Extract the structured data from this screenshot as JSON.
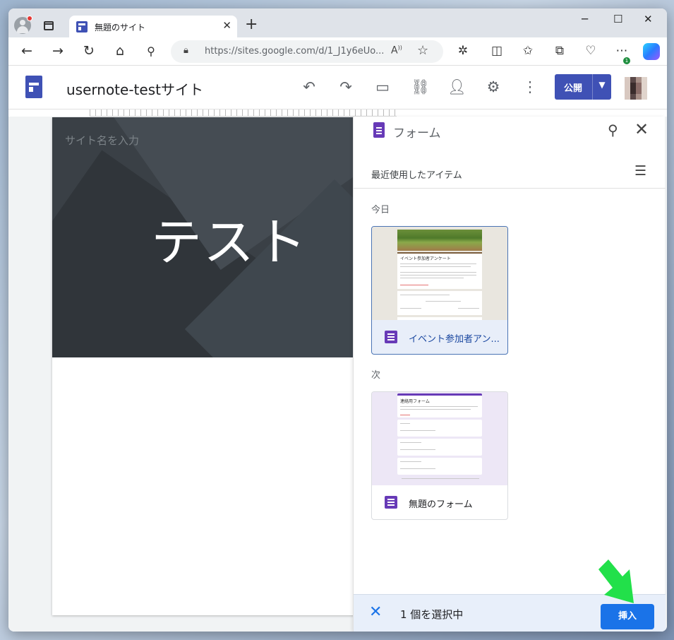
{
  "browser": {
    "tab_title": "無題のサイト",
    "url": "https://sites.google.com/d/1_J1y6eUo..."
  },
  "app": {
    "site_title": "usernote-testサイト",
    "publish_label": "公開"
  },
  "page": {
    "site_name_placeholder": "サイト名を入力",
    "hero_title": "テスト"
  },
  "panel": {
    "title": "フォーム",
    "recent_label": "最近使用したアイテム",
    "section_today": "今日",
    "section_next": "次",
    "items": [
      {
        "name": "イベント参加者アン...",
        "thumb_title": "イベント参加者アンケート",
        "selected": true
      },
      {
        "name": "無題のフォーム",
        "thumb_title": "連絡用フォーム",
        "selected": false
      }
    ],
    "selection_count": "1 個を選択中",
    "insert_label": "挿入"
  },
  "colors": {
    "sites_blue": "#3f51b5",
    "forms_purple": "#673ab7",
    "insert_blue": "#1a73e8",
    "arrow_green": "#22e04a"
  }
}
